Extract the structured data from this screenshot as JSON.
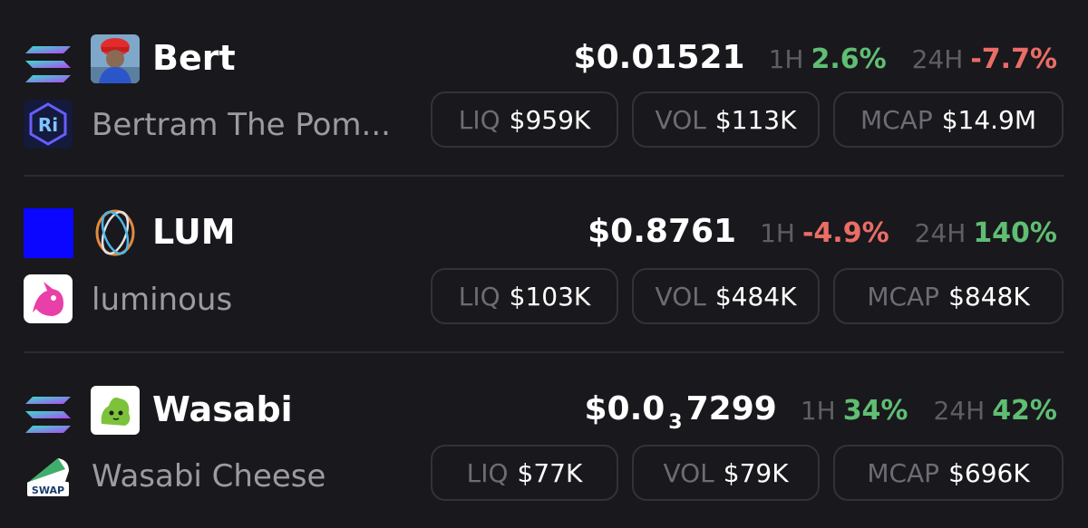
{
  "tokens": [
    {
      "ticker": "Bert",
      "name": "Bertram The Pom...",
      "chain_icon": "solana-icon",
      "dex_icon": "raydium-icon",
      "price": "$0.01521",
      "h1_label": "1H",
      "h1_change": "2.6%",
      "h24_label": "24H",
      "h24_change": "-7.7%",
      "liq_label": "LIQ",
      "liq_value": "$959K",
      "vol_label": "VOL",
      "vol_value": "$113K",
      "mcap_label": "MCAP",
      "mcap_value": "$14.9M"
    },
    {
      "ticker": "LUM",
      "name": "luminous",
      "chain_icon": "blue-square-chain-icon",
      "dex_icon": "uniswap-icon",
      "price": "$0.8761",
      "h1_label": "1H",
      "h1_change": "-4.9%",
      "h24_label": "24H",
      "h24_change": "140%",
      "liq_label": "LIQ",
      "liq_value": "$103K",
      "vol_label": "VOL",
      "vol_value": "$484K",
      "mcap_label": "MCAP",
      "mcap_value": "$848K"
    },
    {
      "ticker": "Wasabi",
      "name": "Wasabi Cheese",
      "chain_icon": "solana-icon",
      "dex_icon": "cheese-swap-icon",
      "dex_badge": "SWAP",
      "price_prefix": "$0.0",
      "price_sub": "3",
      "price_suffix": "7299",
      "h1_label": "1H",
      "h1_change": "34%",
      "h24_label": "24H",
      "h24_change": "42%",
      "liq_label": "LIQ",
      "liq_value": "$77K",
      "vol_label": "VOL",
      "vol_value": "$79K",
      "mcap_label": "MCAP",
      "mcap_value": "$696K"
    }
  ],
  "colors": {
    "background": "#19181d",
    "positive": "#5fbe72",
    "negative": "#ea6d66",
    "pill_border": "#333238",
    "muted_text": "#9c9ba1"
  }
}
